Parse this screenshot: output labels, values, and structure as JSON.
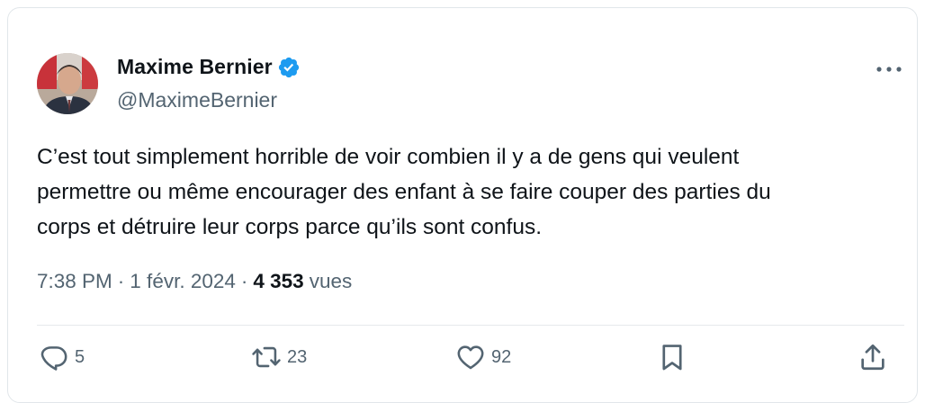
{
  "author": {
    "name": "Maxime Bernier",
    "handle": "@MaximeBernier",
    "verified": true
  },
  "tweet": {
    "text_lines": [
      "C’est tout simplement horrible de voir combien il y a de gens qui veulent",
      "permettre ou même encourager des enfant à se faire couper des parties du",
      "corps et détruire leur corps parce qu’ils sont confus."
    ],
    "time": "7:38 PM",
    "date": "1 févr. 2024",
    "separator": "·",
    "views_count": "4 353",
    "views_label": "vues"
  },
  "actions": {
    "replies": "5",
    "retweets": "23",
    "likes": "92"
  },
  "colors": {
    "text": "#0f1419",
    "secondary": "#536471",
    "verified": "#1d9bf0",
    "divider": "#e6e9ec"
  },
  "icons": [
    "verified-badge-icon",
    "more-icon",
    "reply-icon",
    "retweet-icon",
    "like-icon",
    "bookmark-icon",
    "share-icon"
  ]
}
